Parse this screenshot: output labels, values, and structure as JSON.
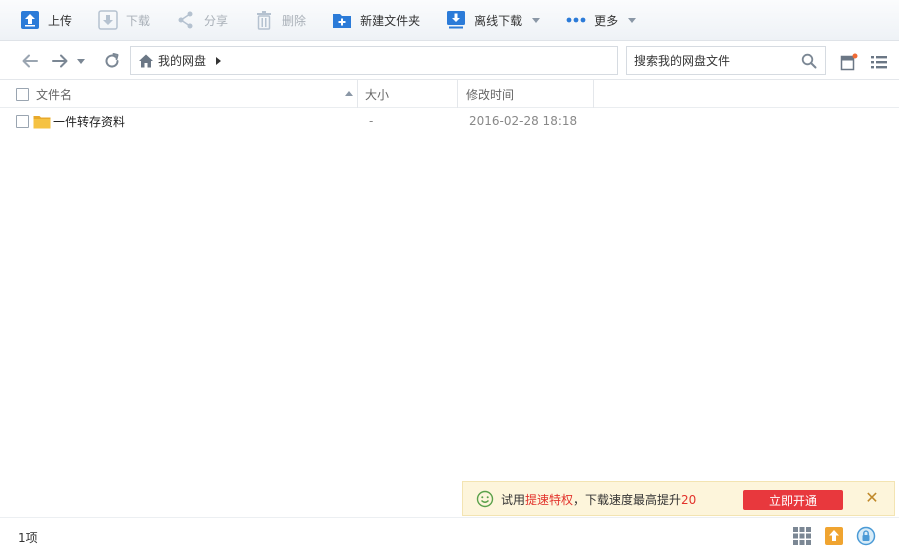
{
  "toolbar": {
    "upload": "上传",
    "download": "下载",
    "share": "分享",
    "delete": "删除",
    "new_folder": "新建文件夹",
    "offline_download": "离线下载",
    "more": "更多"
  },
  "address": {
    "crumb": "我的网盘",
    "search_placeholder": "搜索我的网盘文件"
  },
  "columns": {
    "name": "文件名",
    "size": "大小",
    "modified": "修改时间"
  },
  "files": [
    {
      "name": "一件转存资料",
      "size": "-",
      "modified": "2016-02-28 18:18"
    }
  ],
  "notice": {
    "prefix": "试用",
    "highlight": "提速特权",
    "suffix": "，下载速度最高提升",
    "percent": "20",
    "button": "立即开通"
  },
  "status": {
    "count": "1项"
  },
  "colors": {
    "accent_blue": "#2b7bd8",
    "disabled_icon": "#b5c2d0",
    "notice_bg": "#fdf5db",
    "cta_red": "#e8383d",
    "folder_yellow": "#f5c242"
  }
}
